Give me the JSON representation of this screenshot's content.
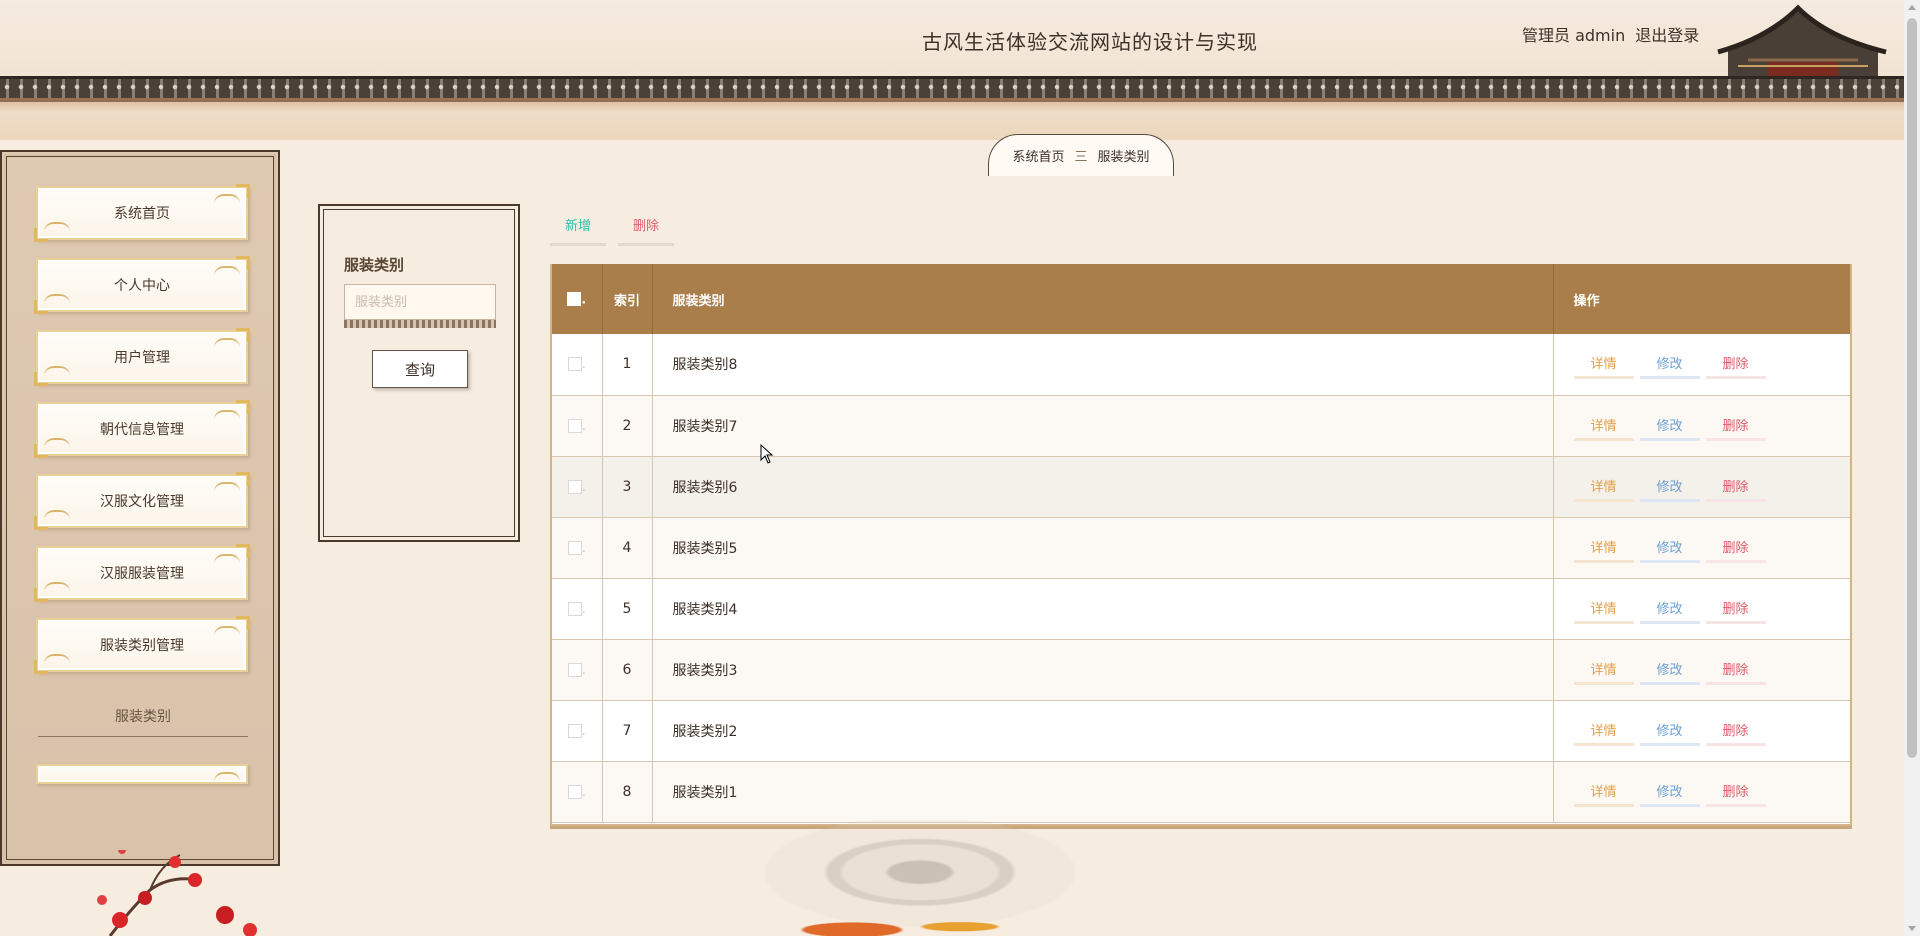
{
  "header": {
    "site_title": "古风生活体验交流网站的设计与实现",
    "user_label": "管理员 admin",
    "logout_label": "退出登录"
  },
  "breadcrumb": {
    "home": "系统首页",
    "separator": "三",
    "current": "服装类别"
  },
  "sidebar": {
    "items": [
      {
        "label": "系统首页"
      },
      {
        "label": "个人中心"
      },
      {
        "label": "用户管理"
      },
      {
        "label": "朝代信息管理"
      },
      {
        "label": "汉服文化管理"
      },
      {
        "label": "汉服服装管理"
      },
      {
        "label": "服装类别管理"
      }
    ],
    "sub_label": "服装类别"
  },
  "search": {
    "label": "服装类别",
    "placeholder": "服装类别",
    "value": "",
    "query_label": "查询"
  },
  "toolbar": {
    "add_label": "新增",
    "delete_label": "删除"
  },
  "table": {
    "headers": {
      "index": "索引",
      "category": "服装类别",
      "actions": "操作"
    },
    "rows": [
      {
        "index": "1",
        "category": "服装类别8"
      },
      {
        "index": "2",
        "category": "服装类别7"
      },
      {
        "index": "3",
        "category": "服装类别6"
      },
      {
        "index": "4",
        "category": "服装类别5"
      },
      {
        "index": "5",
        "category": "服装类别4"
      },
      {
        "index": "6",
        "category": "服装类别3"
      },
      {
        "index": "7",
        "category": "服装类别2"
      },
      {
        "index": "8",
        "category": "服装类别1"
      }
    ],
    "action_labels": {
      "detail": "详情",
      "edit": "修改",
      "delete": "删除"
    }
  },
  "colors": {
    "header_row": "#a97e4b",
    "add_button": "#2fbfb0",
    "delete_button": "#e06070",
    "detail_action": "#e0a04a",
    "edit_action": "#6aa0d8",
    "delete_action": "#e05a6a"
  }
}
